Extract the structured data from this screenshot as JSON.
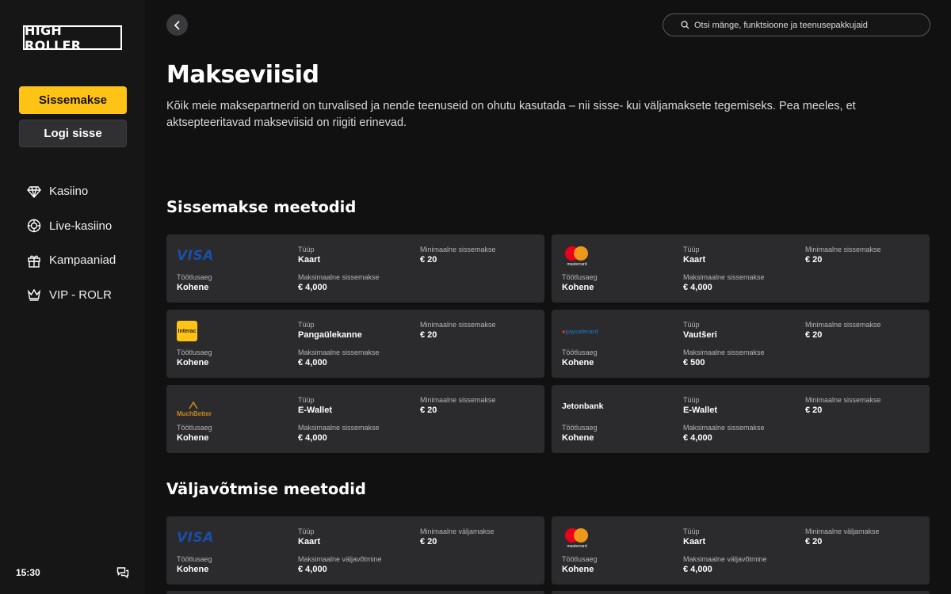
{
  "brand": {
    "logo_text": "HIGH ROLLER"
  },
  "sidebar": {
    "deposit_label": "Sissemakse",
    "login_label": "Logi sisse",
    "items": [
      {
        "label": "Kasiino",
        "icon": "diamond-icon"
      },
      {
        "label": "Live-kasiino",
        "icon": "chip-icon"
      },
      {
        "label": "Kampaaniad",
        "icon": "gift-icon"
      },
      {
        "label": "VIP - ROLR",
        "icon": "crown-icon"
      }
    ],
    "clock": "15:30"
  },
  "search": {
    "placeholder": "Otsi mänge, funktsioone ja teenusepakkujaid"
  },
  "page": {
    "title": "Makseviisid",
    "intro": "Kõik meie maksepartnerid on turvalised ja nende teenuseid on ohutu kasutada – nii sisse- kui väljamaksete tegemiseks. Pea meeles, et aktsepteeritavad makseviisid on riigiti erinevad."
  },
  "deposit_section": {
    "title": "Sissemakse meetodid",
    "labels": {
      "type": "Tüüp",
      "min": "Minimaalne sissemakse",
      "time": "Töötlusaeg",
      "max": "Maksimaalne sissemakse"
    },
    "methods": [
      {
        "provider": "Visa",
        "logo_text": "VISA",
        "type": "Kaart",
        "min": "€ 20",
        "time": "Kohene",
        "max": "€ 4,000"
      },
      {
        "provider": "Mastercard",
        "logo_text": "mastercard",
        "type": "Kaart",
        "min": "€ 20",
        "time": "Kohene",
        "max": "€ 4,000"
      },
      {
        "provider": "Interac",
        "logo_text": "Interac",
        "type": "Pangaülekanne",
        "min": "€ 20",
        "time": "Kohene",
        "max": "€ 4,000"
      },
      {
        "provider": "paysafecard",
        "logo_text": "paysafecard",
        "type": "Vautšeri",
        "min": "€ 20",
        "time": "Kohene",
        "max": "€ 500"
      },
      {
        "provider": "MuchBetter",
        "logo_text": "MuchBetter",
        "type": "E-Wallet",
        "min": "€ 20",
        "time": "Kohene",
        "max": "€ 4,000"
      },
      {
        "provider": "Jetonbank",
        "logo_text": "Jetonbank",
        "type": "E-Wallet",
        "min": "€ 20",
        "time": "Kohene",
        "max": "€ 4,000"
      }
    ]
  },
  "withdraw_section": {
    "title": "Väljavõtmise meetodid",
    "labels": {
      "type": "Tüüp",
      "min": "Minimaalne väljamakse",
      "time": "Töötlusaeg",
      "max": "Maksimaalne väljavõtmine"
    },
    "methods": [
      {
        "provider": "Visa",
        "logo_text": "VISA",
        "type": "Kaart",
        "min": "€ 20",
        "time": "Kohene",
        "max": "€ 4,000"
      },
      {
        "provider": "Mastercard",
        "logo_text": "mastercard",
        "type": "Kaart",
        "min": "€ 20",
        "time": "Kohene",
        "max": "€ 4,000"
      }
    ]
  },
  "colors": {
    "accent": "#ffc316",
    "card_bg": "#2b2b2e",
    "page_bg": "#111111",
    "sidebar_bg": "#161616"
  }
}
